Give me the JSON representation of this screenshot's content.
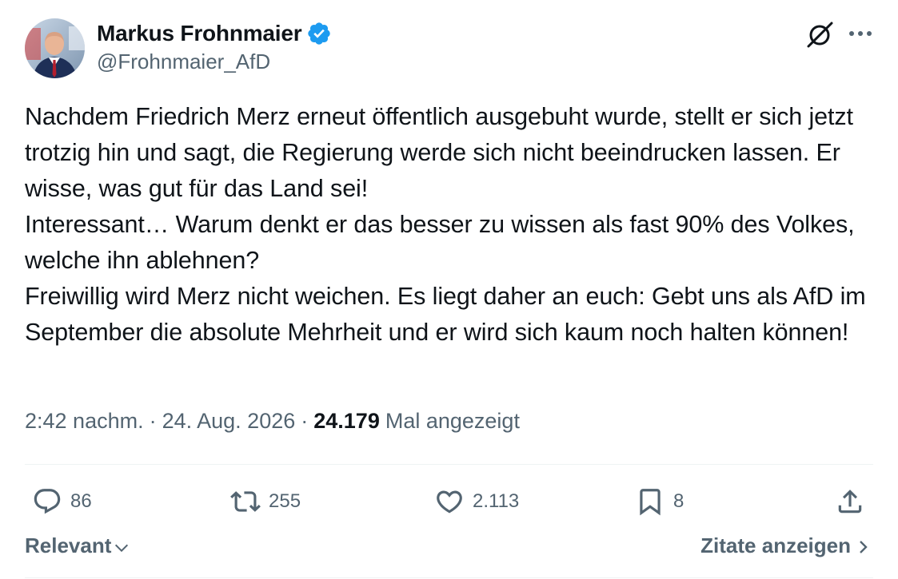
{
  "author": {
    "display_name": "Markus Frohnmaier",
    "handle": "@Frohnmaier_AfD",
    "verified": true
  },
  "icons": {
    "verified": "verified-badge-icon",
    "grok": "grok-icon",
    "more": "more-options-icon",
    "reply": "reply-icon",
    "retweet": "retweet-icon",
    "like": "heart-icon",
    "bookmark": "bookmark-icon",
    "share": "share-icon"
  },
  "colors": {
    "verified_blue": "#1d9bf0",
    "text_primary": "#0f1419",
    "text_secondary": "#536471"
  },
  "tweet": {
    "text": "Nachdem Friedrich Merz erneut öffentlich ausgebuht wurde, stellt er sich jetzt trotzig hin und sagt, die Regierung werde sich nicht beeindrucken lassen. Er wisse, was gut für das Land sei!\nInteressant… Warum denkt er das besser zu wissen als fast 90% des Volkes, welche ihn ablehnen?\nFreiwillig wird Merz nicht weichen. Es liegt daher an euch: Gebt uns als AfD im September die absolute Mehrheit und er wird sich kaum noch halten können!",
    "time": "2:42 nachm.",
    "separator": "·",
    "date": "24. Aug. 2026",
    "views_count": "24.179",
    "views_label": "Mal angezeigt"
  },
  "actions": {
    "replies": "86",
    "retweets": "255",
    "likes": "2.113",
    "bookmarks": "8"
  },
  "footer": {
    "sort_label": "Relevant",
    "quotes_label": "Zitate anzeigen"
  }
}
